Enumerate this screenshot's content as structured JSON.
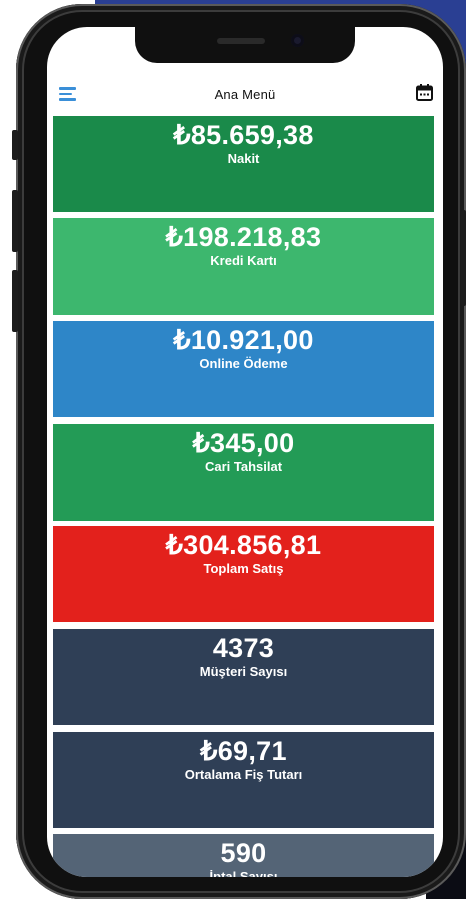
{
  "header": {
    "title": "Ana Menü",
    "menu_icon": "hamburger-menu-icon",
    "calendar_icon": "calendar-icon"
  },
  "cards": [
    {
      "value": "₺85.659,38",
      "label": "Nakit",
      "color": "#1a8a4a"
    },
    {
      "value": "₺198.218,83",
      "label": "Kredi Kartı",
      "color": "#3db76e"
    },
    {
      "value": "₺10.921,00",
      "label": "Online Ödeme",
      "color": "#2e86c8"
    },
    {
      "value": "₺345,00",
      "label": "Cari Tahsilat",
      "color": "#239b56"
    },
    {
      "value": "₺304.856,81",
      "label": "Toplam Satış",
      "color": "#e3211c"
    },
    {
      "value": "4373",
      "label": "Müşteri Sayısı",
      "color": "#2f3f56"
    },
    {
      "value": "₺69,71",
      "label": "Ortalama Fiş Tutarı",
      "color": "#2f3f56"
    },
    {
      "value": "590",
      "label": "İptal Sayısı",
      "color": "#546476"
    }
  ]
}
